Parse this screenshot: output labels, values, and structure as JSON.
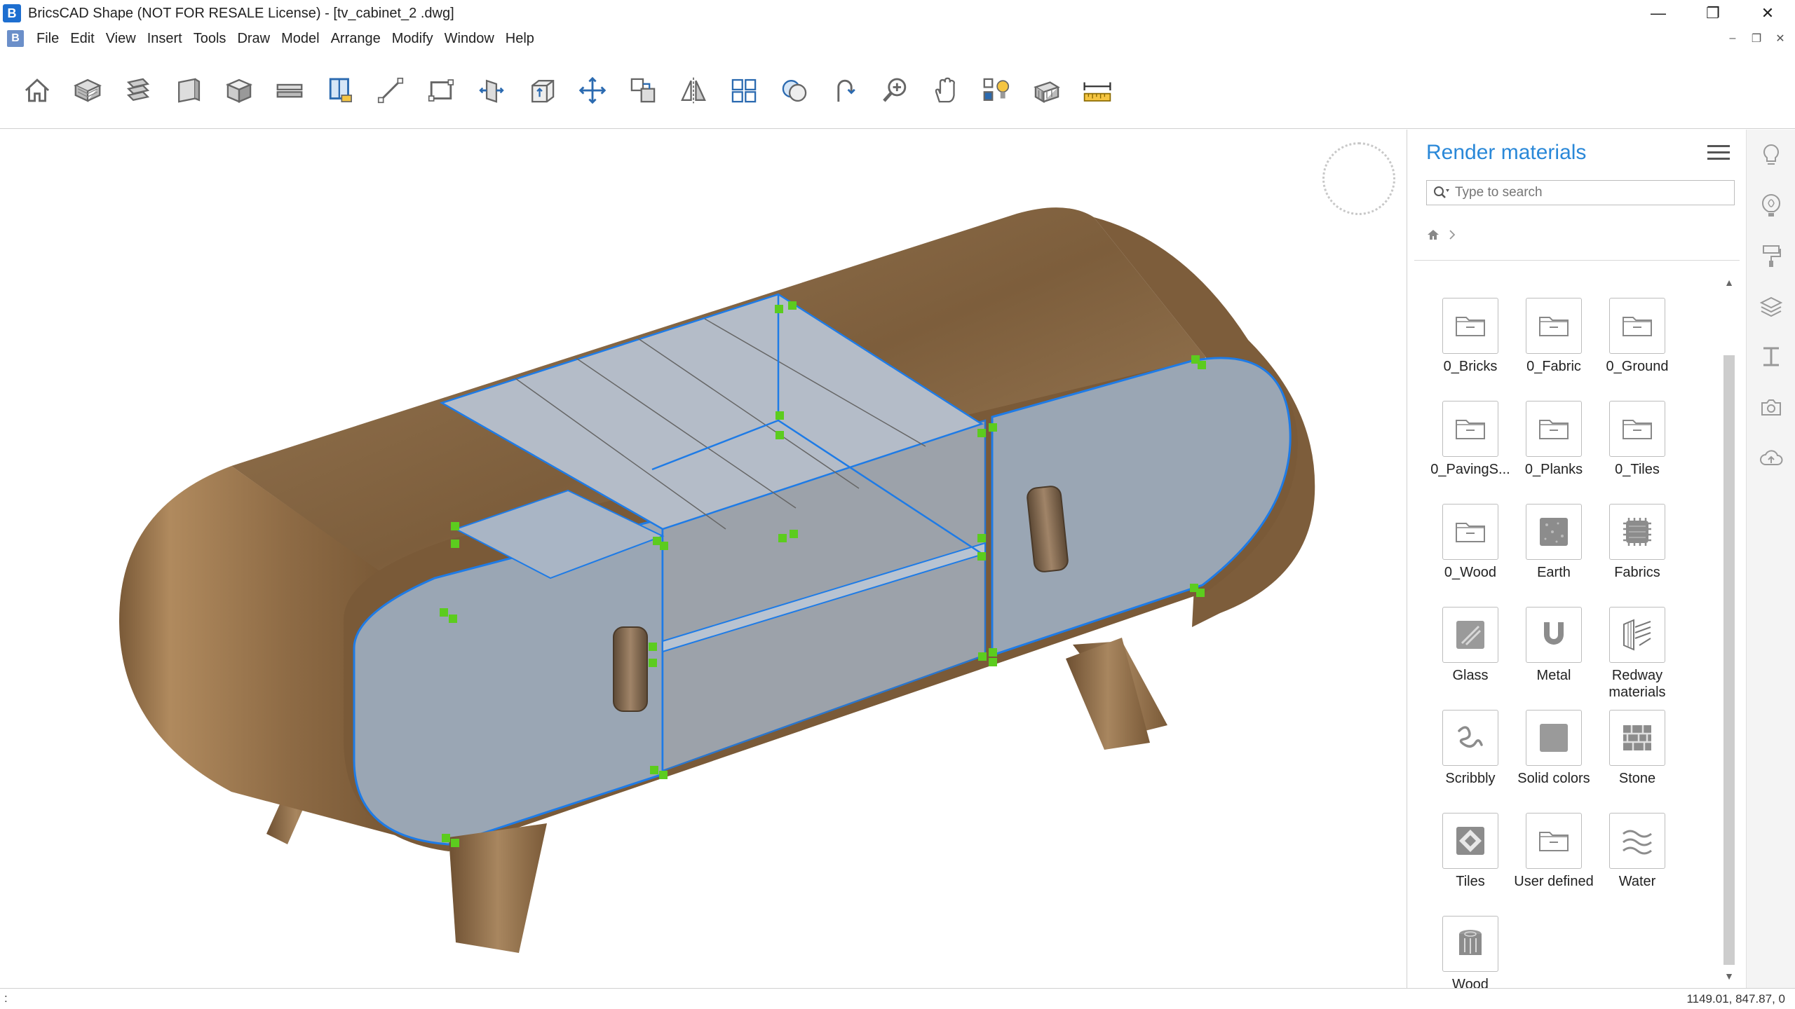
{
  "window": {
    "title": "BricsCAD Shape (NOT FOR RESALE License) - [tv_cabinet_2 .dwg]",
    "app_logo": "B",
    "controls": {
      "minimize": "—",
      "restore": "❐",
      "close": "✕"
    }
  },
  "menubar": {
    "doc_icon": "B",
    "items": [
      "File",
      "Edit",
      "View",
      "Insert",
      "Tools",
      "Draw",
      "Model",
      "Arrange",
      "Modify",
      "Window",
      "Help"
    ],
    "doc_controls": {
      "minimize": "–",
      "restore": "❐",
      "close": "✕"
    }
  },
  "toolbar": {
    "tools": [
      "home-icon",
      "solid-icon",
      "layers-stack-icon",
      "wall-icon",
      "box-icon",
      "slab-icon",
      "window-icon",
      "line-icon",
      "rectangle-icon",
      "push-pull-icon",
      "extrude-box-icon",
      "move-icon",
      "copy-icon",
      "mirror-icon",
      "array-icon",
      "combine-icon",
      "rotate-icon",
      "zoom-icon",
      "pan-hand-icon",
      "light-icon",
      "section-icon",
      "measure-icon"
    ]
  },
  "panel": {
    "title": "Render materials",
    "search_placeholder": "Type to search",
    "materials": [
      {
        "label": "0_Bricks",
        "icon": "folder-icon"
      },
      {
        "label": "0_Fabric",
        "icon": "folder-icon"
      },
      {
        "label": "0_Ground",
        "icon": "folder-icon"
      },
      {
        "label": "0_PavingS...",
        "icon": "folder-icon"
      },
      {
        "label": "0_Planks",
        "icon": "folder-icon"
      },
      {
        "label": "0_Tiles",
        "icon": "folder-icon"
      },
      {
        "label": "0_Wood",
        "icon": "folder-icon"
      },
      {
        "label": "Earth",
        "icon": "earth-icon"
      },
      {
        "label": "Fabrics",
        "icon": "fabrics-icon"
      },
      {
        "label": "Glass",
        "icon": "glass-icon"
      },
      {
        "label": "Metal",
        "icon": "magnet-icon"
      },
      {
        "label": "Redway materials",
        "icon": "redway-icon"
      },
      {
        "label": "Scribbly",
        "icon": "scribbly-icon"
      },
      {
        "label": "Solid colors",
        "icon": "solid-colors-icon"
      },
      {
        "label": "Stone",
        "icon": "stone-icon"
      },
      {
        "label": "Tiles",
        "icon": "tiles-icon"
      },
      {
        "label": "User defined",
        "icon": "folder-icon"
      },
      {
        "label": "Water",
        "icon": "water-icon"
      },
      {
        "label": "Wood",
        "icon": "wood-icon"
      }
    ]
  },
  "rail": {
    "icons": [
      "lightbulb-icon",
      "balloon-icon",
      "paint-roller-icon",
      "layers-icon",
      "i-beam-icon",
      "camera-icon",
      "cloud-icon"
    ]
  },
  "statusbar": {
    "prompt": ":",
    "coords": "1149.01, 847.87, 0"
  },
  "colors": {
    "accent": "#2a88d8",
    "selection": "#1e7be6",
    "grip": "#5ccc1e",
    "wood": "#8a6a45",
    "panel_fill": "#a9b6c6"
  }
}
